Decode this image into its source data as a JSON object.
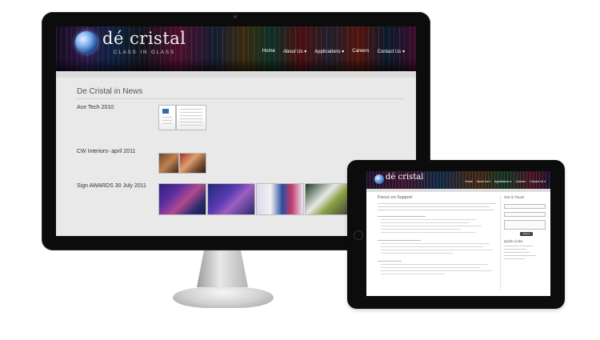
{
  "desktop": {
    "logo": {
      "name": "dé cristal",
      "tagline": "CLASS IN GLASS"
    },
    "nav": [
      "Home",
      "About Us",
      "Applications",
      "Careers",
      "Contact Us"
    ],
    "page_title": "De Cristal in News",
    "news": [
      {
        "title": "Ace Tech 2010"
      },
      {
        "title": "CW Interiors- april 2011"
      },
      {
        "title": "Sign AWARDS 30 July 2011"
      }
    ]
  },
  "tablet": {
    "logo": {
      "name": "dé cristal"
    },
    "nav": [
      "Home",
      "About Us",
      "Applications",
      "Careers",
      "Contact Us"
    ],
    "page_title": "Focus on Support",
    "sidebar": {
      "title": "Get In Touch",
      "quick_links_title": "Quick Links",
      "submit_label": "Submit"
    }
  },
  "colors": {
    "page_bg": "#ffffff",
    "screen_bg": "#e9e9e9",
    "device": "#0c0c0c"
  }
}
